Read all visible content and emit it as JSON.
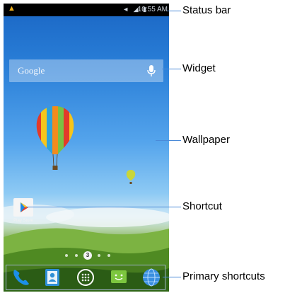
{
  "status_bar": {
    "time": "10:55 AM",
    "icons": "◄ ◢ ▮"
  },
  "widget": {
    "search_label": "Google"
  },
  "shortcut": {
    "label": "Play Store"
  },
  "page_indicator": {
    "current": "3"
  },
  "callouts": {
    "status_bar": "Status bar",
    "widget": "Widget",
    "wallpaper": "Wallpaper",
    "shortcut": "Shortcut",
    "primary_shortcuts": "Primary shortcuts"
  },
  "colors": {
    "callout_line": "#4a8ad8",
    "dock_border": "#9fb4c8"
  },
  "dock_icons": [
    "phone-icon",
    "contacts-icon",
    "apps-icon",
    "messaging-icon",
    "browser-icon"
  ]
}
